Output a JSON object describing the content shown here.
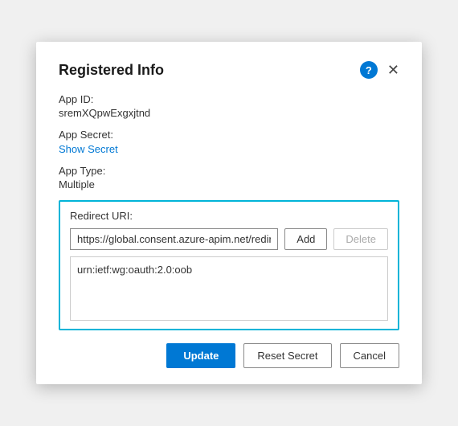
{
  "dialog": {
    "title": "Registered Info",
    "fields": {
      "app_id_label": "App ID:",
      "app_id_value": "sremXQpwExgxjtnd",
      "app_secret_label": "App Secret:",
      "show_secret_link": "Show Secret",
      "app_type_label": "App Type:",
      "app_type_value": "Multiple",
      "redirect_uri_label": "Redirect URI:",
      "redirect_input_value": "https://global.consent.azure-apim.net/redirect",
      "add_button_label": "Add",
      "delete_button_label": "Delete",
      "redirect_list_item": "urn:ietf:wg:oauth:2.0:oob"
    },
    "footer": {
      "update_label": "Update",
      "reset_secret_label": "Reset Secret",
      "cancel_label": "Cancel"
    },
    "icons": {
      "help": "?",
      "close": "✕"
    }
  }
}
